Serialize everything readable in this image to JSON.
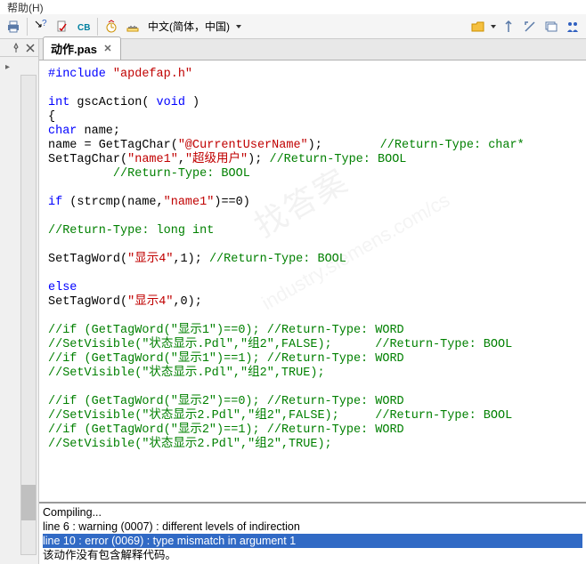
{
  "menu": {
    "help": "帮助(H)"
  },
  "toolbar": {
    "lang": "中文(简体，中国)"
  },
  "tab": {
    "title": "动作.pas"
  },
  "code": {
    "l1_include": "#include",
    "l1_hdr": "\"apdefap.h\"",
    "l3_int": "int",
    "l3_fn": " gscAction( ",
    "l3_void": "void",
    "l3_end": " )",
    "l4_brace": "{",
    "l5_char": "char",
    "l5_decl": " name;",
    "l6_a": "name = GetTagChar(",
    "l6_s": "\"@CurrentUserName\"",
    "l6_b": ");        ",
    "l6_c": "//Return-Type: char*",
    "l7_a": "SetTagChar(",
    "l7_s1": "\"name1\"",
    "l7_m": ",",
    "l7_s2": "\"超级用户\"",
    "l7_b": "); ",
    "l7_c": "//Return-Type: BOOL",
    "l8_c": "         //Return-Type: BOOL",
    "l10_if": "if",
    "l10_a": " (strcmp(name,",
    "l10_s": "\"name1\"",
    "l10_b": ")==0)",
    "l12_c": "//Return-Type: long int",
    "l14_a": "SetTagWord(",
    "l14_s": "\"显示4\"",
    "l14_b": ",1); ",
    "l14_c": "//Return-Type: BOOL",
    "l16_else": "else",
    "l17_a": "SetTagWord(",
    "l17_s": "\"显示4\"",
    "l17_b": ",0);",
    "l19": "//if (GetTagWord(\"显示1\")==0); //Return-Type: WORD",
    "l20": "//SetVisible(\"状态显示.Pdl\",\"组2\",FALSE);      //Return-Type: BOOL",
    "l21": "//if (GetTagWord(\"显示1\")==1); //Return-Type: WORD",
    "l22": "//SetVisible(\"状态显示.Pdl\",\"组2\",TRUE);",
    "l24": "//if (GetTagWord(\"显示2\")==0); //Return-Type: WORD",
    "l25": "//SetVisible(\"状态显示2.Pdl\",\"组2\",FALSE);     //Return-Type: BOOL",
    "l26": "//if (GetTagWord(\"显示2\")==1); //Return-Type: WORD",
    "l27": "//SetVisible(\"状态显示2.Pdl\",\"组2\",TRUE);"
  },
  "output": {
    "o1": "Compiling...",
    "o2": "line 6 : warning (0007) : different levels of indirection",
    "o3": "line 10 : error (0069) : type mismatch in argument 1",
    "o4": "该动作没有包含解释代码。"
  },
  "watermark": {
    "main": "找答案",
    "sub": "industry.siemens.com/cs"
  }
}
